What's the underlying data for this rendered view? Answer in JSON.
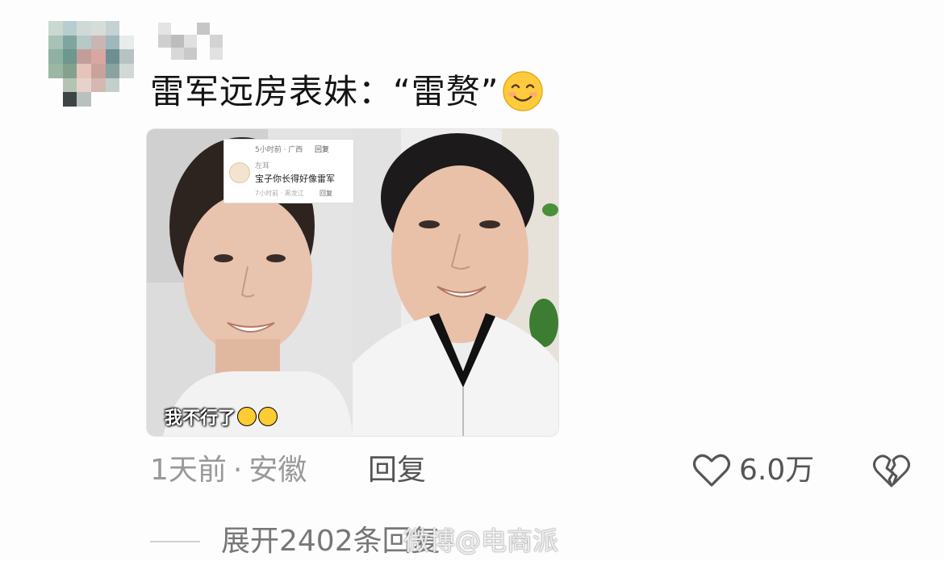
{
  "comment": {
    "text": "雷军远房表妹：“雷赘”",
    "emoji": "smiling-face-emoji",
    "time": "1天前",
    "separator": "·",
    "location": "安徽",
    "reply_label": "回复",
    "like_count": "6.0万",
    "expand_label": "展开2402条回复"
  },
  "image": {
    "inset_comment": {
      "top_meta": "5小时前 · 广西",
      "top_reply": "回复",
      "username": "左耳",
      "text": "宝子你长得好像雷军",
      "bottom_meta": "7小时前 · 黑龙江",
      "bottom_reply": "回复"
    },
    "caption": "我不行了"
  },
  "watermark": "微博@电商派",
  "colors": {
    "text_primary": "#141414",
    "text_meta": "#999999",
    "text_action": "#555555"
  }
}
